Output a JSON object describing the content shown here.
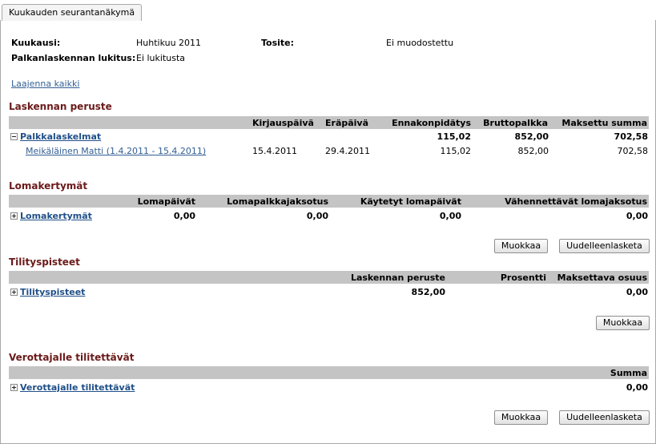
{
  "tab": {
    "label": "Kuukauden seurantanäkymä"
  },
  "summary": {
    "month_label": "Kuukausi:",
    "month_value": "Huhtikuu 2011",
    "voucher_label": "Tosite:",
    "voucher_value": "Ei muodostettu",
    "lock_label": "Palkanlaskennan lukitus:",
    "lock_value": "Ei lukitusta"
  },
  "expand_all": "Laajenna kaikki",
  "basis": {
    "title": "Laskennan peruste",
    "headers": [
      "Kirjauspäivä",
      "Eräpäivä",
      "Ennakonpidätys",
      "Bruttopalkka",
      "Maksettu summa"
    ],
    "group": {
      "label": "Palkkalaskelmat",
      "withholding": "115,02",
      "gross": "852,00",
      "paid": "702,58"
    },
    "rows": [
      {
        "name": "Meikäläinen Matti (1.4.2011 - 15.4.2011)",
        "posted": "15.4.2011",
        "due": "29.4.2011",
        "withholding": "115,02",
        "gross": "852,00",
        "paid": "702,58"
      }
    ]
  },
  "holiday": {
    "title": "Lomakertymät",
    "headers": [
      "Lomapäivät",
      "Lomapalkkajaksotus",
      "Käytetyt lomapäivät",
      "Vähennettävät lomajaksotus"
    ],
    "group": {
      "label": "Lomakertymät",
      "days": "0,00",
      "accrual": "0,00",
      "used": "0,00",
      "deducted": "0,00"
    },
    "edit": "Muokkaa",
    "recalc": "Uudelleenlasketa"
  },
  "settlement": {
    "title": "Tilityspisteet",
    "headers": [
      "Laskennan peruste",
      "Prosentti",
      "Maksettava osuus"
    ],
    "group": {
      "label": "Tilityspisteet",
      "basis": "852,00",
      "percent": "",
      "payable": "0,00"
    },
    "edit": "Muokkaa"
  },
  "tax": {
    "title": "Verottajalle tilitettävät",
    "headers": [
      "Summa"
    ],
    "group": {
      "label": "Verottajalle tilitettävät",
      "sum": "0,00"
    },
    "edit": "Muokkaa",
    "recalc": "Uudelleenlasketa"
  }
}
